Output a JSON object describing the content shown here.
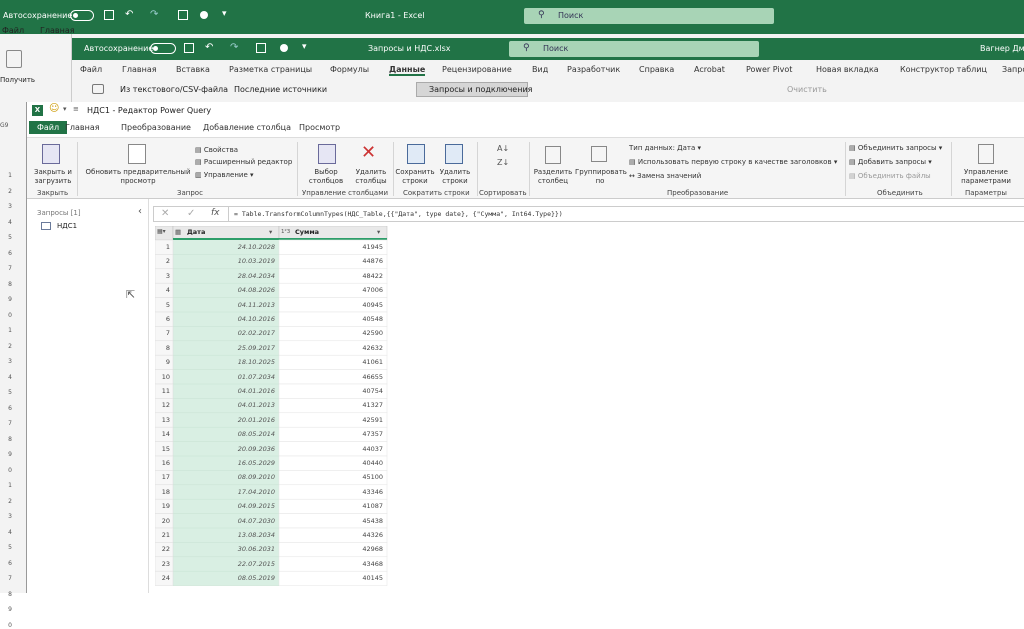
{
  "back_window_1": {
    "autosave_label": "Автосохранение",
    "title": "Книга1 - Excel",
    "search_placeholder": "Поиск",
    "tab_file": "Файл",
    "tab_home": "Главная",
    "get_data_label": "Получить",
    "cell_ref": "G9",
    "row_numbers": [
      "1",
      "2",
      "3",
      "4",
      "5",
      "6",
      "7",
      "8",
      "9",
      "0",
      "1",
      "2",
      "3",
      "4",
      "5",
      "6",
      "7",
      "8",
      "9",
      "0",
      "1",
      "2",
      "3",
      "4",
      "5",
      "6",
      "7",
      "8",
      "9",
      "0"
    ]
  },
  "back_window_2": {
    "autosave_label": "Автосохранение",
    "title": "Запросы и НДС.xlsx",
    "search_placeholder": "Поиск",
    "user": "Вагнер Дмитрий",
    "tabs": [
      "Файл",
      "Главная",
      "Вставка",
      "Разметка страницы",
      "Формулы",
      "Данные",
      "Рецензирование",
      "Вид",
      "Разработчик",
      "Справка",
      "Acrobat",
      "Power Pivot",
      "Новая вкладка",
      "Конструктор таблиц",
      "Запро"
    ],
    "active_tab": "Данные",
    "from_csv": "Из текстового/CSV-файла",
    "recent_sources": "Последние источники",
    "queries_connections": "Запросы и подключения",
    "clear": "Очистить"
  },
  "pq": {
    "title": "НДС1 - Редактор Power Query",
    "tabs": [
      "Файл",
      "Главная",
      "Преобразование",
      "Добавление столбца",
      "Просмотр"
    ],
    "ribbon": {
      "close_load": "Закрыть и загрузить",
      "close_group": "Закрыть",
      "refresh_preview": "Обновить предварительный просмотр",
      "properties": "Свойства",
      "advanced_editor": "Расширенный редактор",
      "manage": "Управление",
      "query_group": "Запрос",
      "choose_columns": "Выбор столбцов",
      "remove_columns": "Удалить столбцы",
      "manage_columns_group": "Управление столбцами",
      "keep_rows": "Сохранить строки",
      "remove_rows": "Удалить строки",
      "reduce_rows_group": "Сократить строки",
      "sort_group": "Сортировать",
      "split_column": "Разделить столбец",
      "group_by": "Группировать по",
      "data_type": "Тип данных: Дата",
      "use_first_row": "Использовать первую строку в качестве заголовков",
      "replace_values": "Замена значений",
      "transform_group": "Преобразование",
      "merge_queries": "Объединить запросы",
      "append_queries": "Добавить запросы",
      "combine_files": "Объединить файлы",
      "combine_group": "Объединить",
      "manage_parameters": "Управление параметрами",
      "parameters_group": "Параметры"
    },
    "sidebar": {
      "title": "Запросы [1]",
      "query_name": "НДС1"
    },
    "formula": "= Table.TransformColumnTypes(НДС_Table,{{\"Дата\", type date}, {\"Сумма\", Int64.Type}})",
    "columns": [
      "Дата",
      "Сумма"
    ],
    "rows": [
      [
        "1",
        "24.10.2028",
        "41945"
      ],
      [
        "2",
        "10.03.2019",
        "44876"
      ],
      [
        "3",
        "28.04.2034",
        "48422"
      ],
      [
        "4",
        "04.08.2026",
        "47006"
      ],
      [
        "5",
        "04.11.2013",
        "40945"
      ],
      [
        "6",
        "04.10.2016",
        "40548"
      ],
      [
        "7",
        "02.02.2017",
        "42590"
      ],
      [
        "8",
        "25.09.2017",
        "42632"
      ],
      [
        "9",
        "18.10.2025",
        "41061"
      ],
      [
        "10",
        "01.07.2034",
        "46655"
      ],
      [
        "11",
        "04.01.2016",
        "40754"
      ],
      [
        "12",
        "04.01.2013",
        "41327"
      ],
      [
        "13",
        "20.01.2016",
        "42591"
      ],
      [
        "14",
        "08.05.2014",
        "47357"
      ],
      [
        "15",
        "20.09.2036",
        "44037"
      ],
      [
        "16",
        "16.05.2029",
        "40440"
      ],
      [
        "17",
        "08.09.2010",
        "45100"
      ],
      [
        "18",
        "17.04.2010",
        "43346"
      ],
      [
        "19",
        "04.09.2015",
        "41087"
      ],
      [
        "20",
        "04.07.2030",
        "45438"
      ],
      [
        "21",
        "13.08.2034",
        "44326"
      ],
      [
        "22",
        "30.06.2031",
        "42968"
      ],
      [
        "23",
        "22.07.2015",
        "43468"
      ],
      [
        "24",
        "08.05.2019",
        "40145"
      ]
    ]
  },
  "colors": {
    "excel_green": "#217346",
    "selected_column": "#d9efe3",
    "column_underline": "#2e9e6a"
  }
}
